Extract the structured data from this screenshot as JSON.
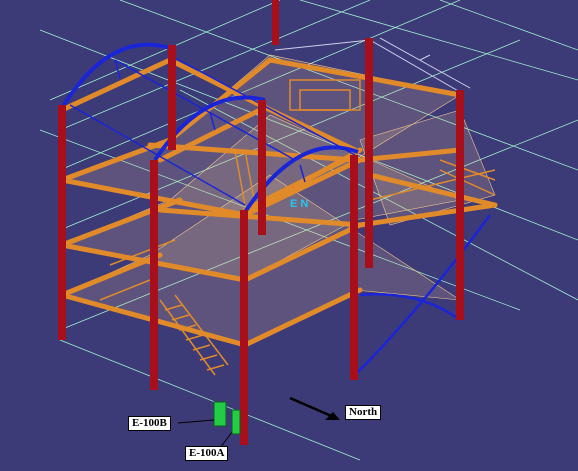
{
  "viewport": {
    "background": "#3d3a78",
    "colors": {
      "column": "#a80f1a",
      "beam": "#e08a2a",
      "deck_grid": "#f0c690",
      "truss": "#1a25d8",
      "grid_lines": "#9ff0d0",
      "equipment": "#22cc44"
    }
  },
  "labels": {
    "equipment_b": "E-100B",
    "equipment_a": "E-100A",
    "north": "North"
  },
  "model_text": {
    "axis_marker": "E    N"
  },
  "icons": {
    "north_arrow": "north-arrow-icon"
  }
}
